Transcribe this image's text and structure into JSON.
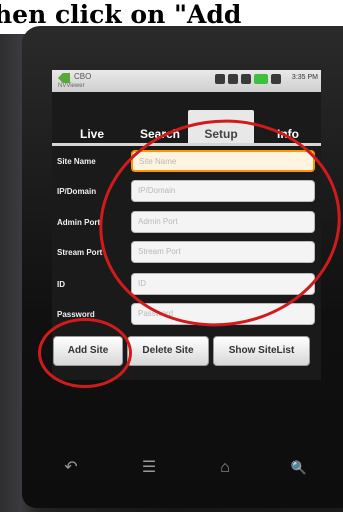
{
  "caption": "hen click on \"Add",
  "status_bar": {
    "app_title": "CBO",
    "app_subtitle": "NVViewer",
    "time": "3:35 PM"
  },
  "tabs": [
    {
      "label": "Live",
      "active": false
    },
    {
      "label": "Search",
      "active": false
    },
    {
      "label": "Setup",
      "active": true
    },
    {
      "label": "Info",
      "active": false
    }
  ],
  "form": {
    "fields": [
      {
        "label": "Site Name",
        "placeholder": "Site Name"
      },
      {
        "label": "IP/Domain",
        "placeholder": "IP/Domain"
      },
      {
        "label": "Admin Port",
        "placeholder": "Admin Port"
      },
      {
        "label": "Stream Port",
        "placeholder": "Stream Port"
      },
      {
        "label": "ID",
        "placeholder": "ID"
      },
      {
        "label": "Password",
        "placeholder": "Password"
      }
    ]
  },
  "buttons": {
    "add_site": "Add Site",
    "delete_site": "Delete Site",
    "show_sitelist": "Show SiteList"
  },
  "nav": {
    "back": "↶",
    "menu": "☰",
    "home": "⌂",
    "search": "🔍"
  },
  "colors": {
    "annotation_red": "#d11b1b",
    "focus_orange": "#ff9500",
    "status_green": "#3fbf3f"
  }
}
